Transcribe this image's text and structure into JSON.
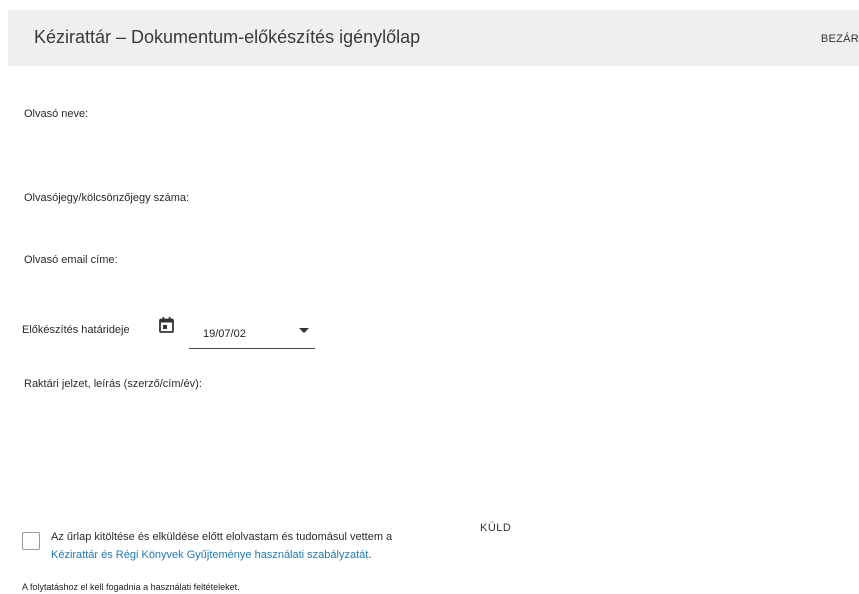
{
  "header": {
    "title": "Kézirattár – Dokumentum-előkészítés igénylőlap",
    "close_label": "BEZÁR"
  },
  "form": {
    "reader_name_label": "Olvasó neve:",
    "card_number_label": "Olvasójegy/kölcsönzőjegy száma:",
    "email_label": "Olvasó email címe:",
    "deadline_label": "Előkészítés határideje",
    "deadline_value": "19/07/02",
    "description_label": "Raktári jelzet, leírás (szerző/cím/év):"
  },
  "consent": {
    "text": "Az űrlap kitöltése és elküldése előtt elolvastam és tudomásul vettem a",
    "link": "Kézirattár és Régi Könyvek Gyűjteménye használati szabályzatát",
    "suffix": "."
  },
  "send_label": "KÜLD",
  "footnote": "A folytatáshoz el kell fogadnia a használati feltételeket.",
  "colors": {
    "header_bg": "#efefef",
    "link": "#1f7ab8"
  },
  "icons": {
    "calendar": "calendar-icon",
    "dropdown": "chevron-down-icon"
  }
}
